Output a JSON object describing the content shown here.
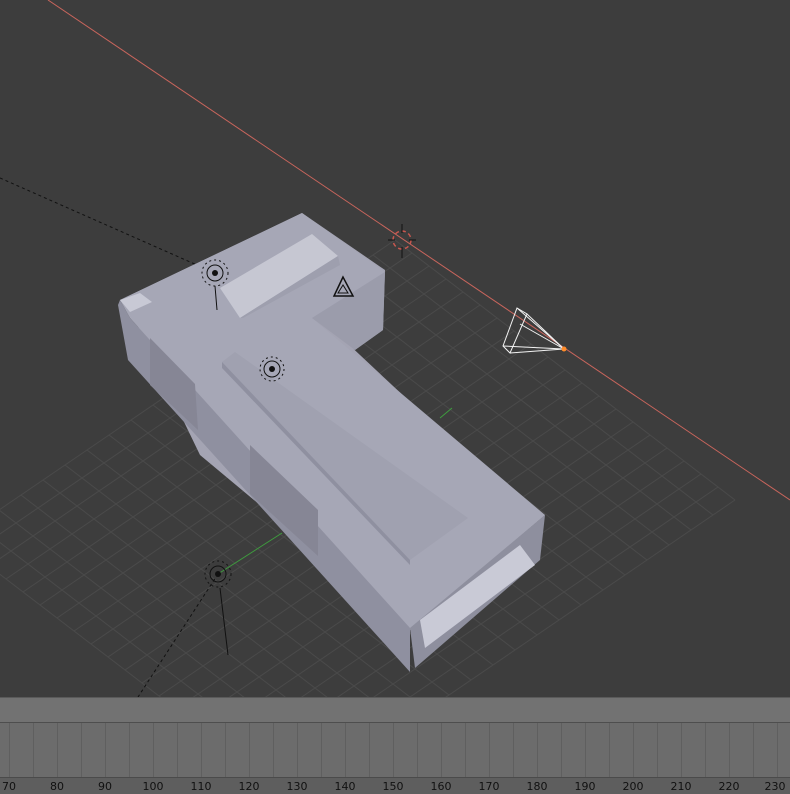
{
  "viewport": {
    "background": "#3d3d3d",
    "selection_color": "#ff8c2a",
    "axis_x_color": "#c8655c",
    "axis_y_color": "#3e9c3e",
    "grid_color": "#5a5a5a",
    "mesh_color": "#9a9bb0",
    "icons": [
      "3d-cursor-icon",
      "lamp-icon",
      "camera-icon",
      "empty-icon"
    ]
  },
  "timeline": {
    "frame_labels": [
      "70",
      "80",
      "90",
      "100",
      "110",
      "120",
      "130",
      "140",
      "150",
      "160",
      "170",
      "180",
      "190",
      "200",
      "210",
      "220",
      "230"
    ]
  }
}
